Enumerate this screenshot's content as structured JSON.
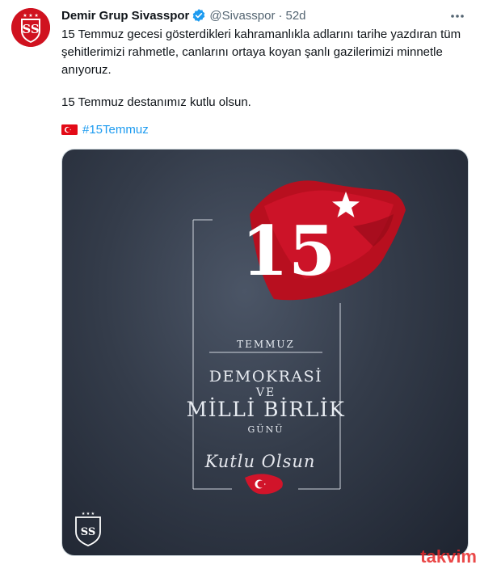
{
  "tweet": {
    "author_name": "Demir Grup Sivasspor",
    "handle": "@Sivasspor",
    "separator": "·",
    "time": "52d",
    "body_line1": "15 Temmuz gecesi gösterdikleri kahramanlıkla adlarını tarihe yazdıran tüm şehitlerimizi rahmetle, canlarını ortaya koyan şanlı gazilerimizi minnetle anıyoruz.",
    "body_line2": "15 Temmuz destanımız kutlu olsun.",
    "hashtag": "#15Temmuz",
    "icons": [
      "verified-badge-icon",
      "more-options-icon",
      "turkey-flag-emoji"
    ]
  },
  "media": {
    "big_number": "15",
    "temmuz": "TEMMUZ",
    "demokrasi": "DEMOKRASİ",
    "ve": "VE",
    "milli_birlik": "MİLLİ BİRLİK",
    "gunu": "GÜNÜ",
    "kutlu_olsun": "Kutlu Olsun",
    "colors": {
      "flag_red": "#c8102e",
      "background": "#343c4a"
    }
  },
  "watermark": "takvim"
}
